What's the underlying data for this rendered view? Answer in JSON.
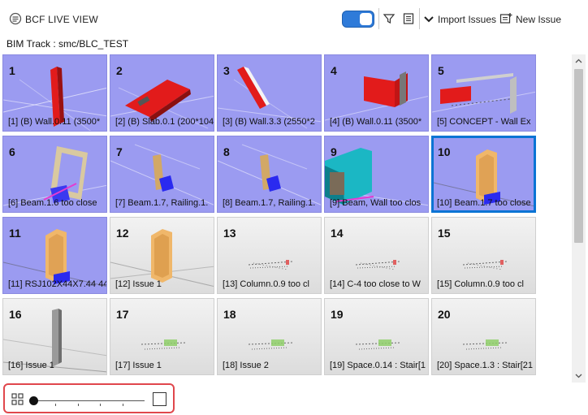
{
  "app": {
    "title": "BCF LIVE VIEW",
    "logo_icon": "bcf-logo-icon"
  },
  "toolbar": {
    "live_toggle": {
      "on": true,
      "color": "#2f7bd9"
    },
    "filter_icon": "filter-icon",
    "list_icon": "list-view-icon",
    "import_label": "Import Issues",
    "import_icon": "chevron-down-icon",
    "new_issue_label": "New Issue",
    "new_issue_icon": "new-issue-icon"
  },
  "breadcrumb": {
    "text": "BIM Track : smc/BLC_TEST"
  },
  "issues": [
    {
      "number": "1",
      "caption": "[1] (B) Wall.0.11 (3500*",
      "style": "purple",
      "thumb": "red-wall"
    },
    {
      "number": "2",
      "caption": "[2] (B) Slab.0.1 (200*104",
      "style": "purple",
      "thumb": "red-slab"
    },
    {
      "number": "3",
      "caption": "[3] (B) Wall.3.3 (2550*2",
      "style": "purple",
      "thumb": "red-slab-tilt"
    },
    {
      "number": "4",
      "caption": "[4] (B) Wall.0.11 (3500*",
      "style": "purple",
      "thumb": "red-corner"
    },
    {
      "number": "5",
      "caption": "[5] CONCEPT - Wall Ex",
      "style": "purple",
      "thumb": "concept"
    },
    {
      "number": "6",
      "caption": "[6] Beam.1.6 too close",
      "style": "purple",
      "thumb": "frame"
    },
    {
      "number": "7",
      "caption": "[7] Beam.1.7, Railing.1.",
      "style": "purple",
      "thumb": "railing"
    },
    {
      "number": "8",
      "caption": "[8] Beam.1.7, Railing.1.",
      "style": "purple",
      "thumb": "railing"
    },
    {
      "number": "9",
      "caption": "[9] Beam, Wall too clos",
      "style": "purple",
      "thumb": "teal-box"
    },
    {
      "number": "10",
      "caption": "[10] Beam.1.7 too close",
      "style": "purple",
      "thumb": "door",
      "selected": true
    },
    {
      "number": "11",
      "caption": "[11] RSJ102X44X7.44 44",
      "style": "purple",
      "thumb": "door"
    },
    {
      "number": "12",
      "caption": "[12] Issue 1",
      "style": "gray",
      "thumb": "door-wire"
    },
    {
      "number": "13",
      "caption": "[13] Column.0.9 too cl",
      "style": "gray",
      "thumb": "small-model"
    },
    {
      "number": "14",
      "caption": "[14] C-4 too close to W",
      "style": "gray",
      "thumb": "small-model"
    },
    {
      "number": "15",
      "caption": "[15] Column.0.9 too cl",
      "style": "gray",
      "thumb": "small-model"
    },
    {
      "number": "16",
      "caption": "[16] Issue 1",
      "style": "gray",
      "thumb": "column"
    },
    {
      "number": "17",
      "caption": "[17] Issue 1",
      "style": "gray",
      "thumb": "green-model"
    },
    {
      "number": "18",
      "caption": "[18] Issue 2",
      "style": "gray",
      "thumb": "green-model"
    },
    {
      "number": "19",
      "caption": "[19] Space.0.14 : Stair[1",
      "style": "gray",
      "thumb": "green-model"
    },
    {
      "number": "20",
      "caption": "[20] Space.1.3 : Stair[21",
      "style": "gray",
      "thumb": "green-model"
    }
  ],
  "zoom": {
    "level_fraction": 0.0,
    "grid_icon": "grid-view-icon",
    "single_icon": "single-view-icon",
    "ticks": 4
  }
}
